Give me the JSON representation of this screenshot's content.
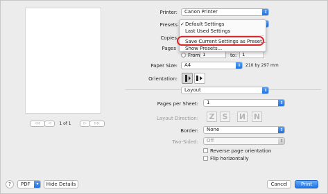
{
  "preview": {
    "page_indicator": "1 of 1",
    "first_label": "◁◁",
    "prev_label": "◁",
    "next_label": "▷",
    "last_label": "▷▷"
  },
  "printer": {
    "label": "Printer:",
    "value": "Canon Printer"
  },
  "presets": {
    "label": "Presets",
    "menu": {
      "items": [
        {
          "label": "Default Settings",
          "checked": true
        },
        {
          "label": "Last Used Settings",
          "checked": false
        },
        {
          "label": "Save Current Settings as Preset...",
          "checked": false,
          "highlighted": true
        },
        {
          "label": "Show Presets...",
          "checked": false
        }
      ],
      "check_glyph": "✓"
    }
  },
  "copies": {
    "label": "Copies"
  },
  "pages": {
    "label": "Pages",
    "from_label": "From:",
    "from_value": "1",
    "to_label": "to:",
    "to_value": "1"
  },
  "paper_size": {
    "label": "Paper Size:",
    "value": "A4",
    "dimensions": "210 by 297 mm"
  },
  "orientation": {
    "label": "Orientation:",
    "portrait_icon": "portrait-icon",
    "landscape_icon": "landscape-icon"
  },
  "section": {
    "value": "Layout"
  },
  "pages_per_sheet": {
    "label": "Pages per Sheet:",
    "value": "1"
  },
  "layout_direction": {
    "label": "Layout Direction:",
    "glyphs": [
      "Z",
      "S",
      "И",
      "N"
    ]
  },
  "border": {
    "label": "Border:",
    "value": "None"
  },
  "two_sided": {
    "label": "Two-Sided:",
    "value": "Off"
  },
  "reverse_orientation": {
    "label": "Reverse page orientation",
    "checked": false
  },
  "flip_horizontally": {
    "label": "Flip horizontally",
    "checked": false
  },
  "footer": {
    "help_label": "?",
    "pdf_label": "PDF",
    "hide_details_label": "Hide Details",
    "cancel_label": "Cancel",
    "print_label": "Print"
  },
  "colors": {
    "accent": "#1f72e6",
    "highlight_ring": "#d9262b"
  }
}
